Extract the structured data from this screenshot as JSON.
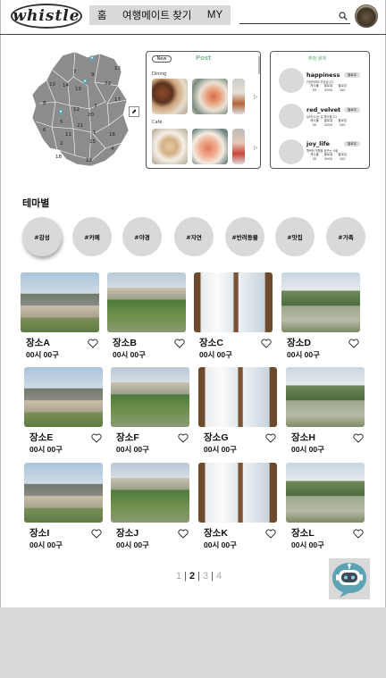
{
  "header": {
    "logo_text": "whistle",
    "nav": [
      "홈",
      "여행메이트 찾기",
      "MY"
    ],
    "search_placeholder": ""
  },
  "map": {
    "region_numbers": [
      "7",
      "9",
      "13",
      "10",
      "14",
      "19",
      "22",
      "8",
      "12",
      "17",
      "3",
      "20",
      "5",
      "2",
      "11",
      "21",
      "1",
      "16",
      "6",
      "15",
      "4",
      "18",
      "23"
    ]
  },
  "post_panel": {
    "new_label": "New",
    "title": "Post",
    "categories": [
      "Dining",
      "Cafe"
    ]
  },
  "user_panel": {
    "title": "추천 유저",
    "follow_label": "팔로우",
    "stat_labels": [
      "게시물",
      "팔로워",
      "팔로잉"
    ],
    "users": [
      {
        "name": "happiness",
        "desc": "안녕하세요 반갑습니다",
        "stats": [
          "50",
          "2000",
          "100"
        ]
      },
      {
        "name": "red_velvet",
        "desc": "놀러다니는 걸 좋아합니다",
        "stats": [
          "50",
          "2000",
          "100"
        ]
      },
      {
        "name": "joy_life",
        "desc": "행복한 여행을 꿈꾸는 사람",
        "stats": [
          "50",
          "2000",
          "100"
        ]
      }
    ]
  },
  "themes": {
    "title": "테마별",
    "items": [
      "#감성",
      "#카페",
      "#야경",
      "#자연",
      "#반려동물",
      "#맛집",
      "#가족"
    ]
  },
  "places": [
    {
      "name": "장소A",
      "time": "00시 00구",
      "photo": "house"
    },
    {
      "name": "장소B",
      "time": "00시 00구",
      "photo": "garden"
    },
    {
      "name": "장소C",
      "time": "00시 00구",
      "photo": "window"
    },
    {
      "name": "장소D",
      "time": "00시 00구",
      "photo": "cedar"
    },
    {
      "name": "장소E",
      "time": "00시 00구",
      "photo": "house"
    },
    {
      "name": "장소F",
      "time": "00시 00구",
      "photo": "garden"
    },
    {
      "name": "장소G",
      "time": "00시 00구",
      "photo": "window"
    },
    {
      "name": "장소H",
      "time": "00시 00구",
      "photo": "cedar"
    },
    {
      "name": "장소I",
      "time": "00시 00구",
      "photo": "house"
    },
    {
      "name": "장소J",
      "time": "00시 00구",
      "photo": "garden"
    },
    {
      "name": "장소K",
      "time": "00시 00구",
      "photo": "window"
    },
    {
      "name": "장소L",
      "time": "00시 00구",
      "photo": "cedar"
    }
  ],
  "pagination": {
    "pages": [
      "1",
      "2",
      "3",
      "4"
    ],
    "current": "2"
  },
  "chatbot": {
    "icon": "robot-chat-icon",
    "color": "#5ea3b4"
  }
}
